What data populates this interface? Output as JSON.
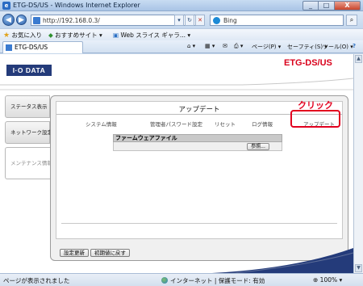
{
  "window": {
    "title": "ETG-DS/US - Windows Internet Explorer",
    "controls": [
      "_",
      "□",
      "X"
    ]
  },
  "browser": {
    "address": "http://192.168.0.3/",
    "search_engine": "Bing",
    "favorites": {
      "favorites_label": "お気に入り",
      "suggested_sites": "おすすめサイト ▾",
      "web_slice_gallery": "Web スライス ギャラ... ▾"
    },
    "tab_title": "ETG-DS/US",
    "command_bar": {
      "page": "ページ(P) ▾",
      "safety": "セーフティ(S) ▾",
      "tools": "ツール(O) ▾",
      "help": "?"
    }
  },
  "page": {
    "brand": "I·O DATA",
    "product": "ETG-DS/US",
    "sidebar": [
      {
        "label": "ステータス表示",
        "active": false
      },
      {
        "label": "ネットワーク設定",
        "active": false
      },
      {
        "label": "メンテナンス情報",
        "active": true
      }
    ],
    "panel_title": "アップデート",
    "menu": [
      "システム情報",
      "管理者パスワード設定",
      "リセット",
      "ログ情報",
      "アップデート"
    ],
    "firmware_section": {
      "heading": "ファームウェアファイル",
      "browse_button": "参照..."
    },
    "footer_buttons": [
      "設定更新",
      "初期値に戻す"
    ]
  },
  "annotation": {
    "label": "クリック",
    "color": "#e2001f"
  },
  "statusbar": {
    "message": "ページが表示されました",
    "zone": "インターネット | 保護モード: 有効",
    "zoom": "100%"
  },
  "colors": {
    "brand": "#243b7a",
    "accent_red": "#d9001b"
  }
}
